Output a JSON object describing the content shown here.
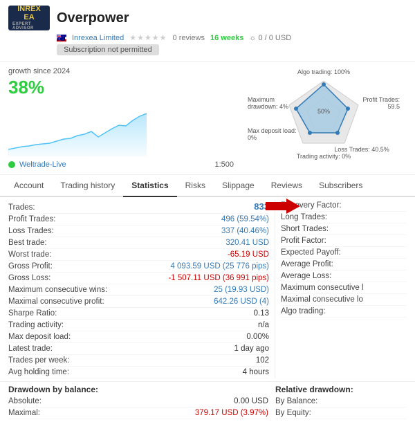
{
  "header": {
    "title": "Overpower",
    "logo_line1": "INREX EA",
    "logo_sub": "EXPERT ADVISOR",
    "provider": "Inrexea Limited",
    "stars": "★★★★★",
    "reviews_count": "0 reviews",
    "weeks": "16 weeks",
    "usd_info": "0 / 0 USD",
    "subscription_label": "Subscription not permitted"
  },
  "growth": {
    "since_label": "growth since 2024",
    "percent": "38%"
  },
  "server": {
    "name": "Weltrade-Live",
    "ratio": "1:500"
  },
  "radar": {
    "algo_label": "Algo trading: 100%",
    "profit_label": "Profit Trades:",
    "profit_value": "59.5",
    "loss_label": "Loss Trades: 40.5%",
    "max_drawdown_label": "Maximum drawdown: 4%",
    "max_deposit_label": "Max deposit load: 0%",
    "trading_activity_label": "Trading activity: 0%"
  },
  "tabs": [
    {
      "label": "Account",
      "active": false
    },
    {
      "label": "Trading history",
      "active": false
    },
    {
      "label": "Statistics",
      "active": true
    },
    {
      "label": "Risks",
      "active": false
    },
    {
      "label": "Slippage",
      "active": false
    },
    {
      "label": "Reviews",
      "active": false
    },
    {
      "label": "Subscribers",
      "active": false
    }
  ],
  "stats_left": [
    {
      "label": "Trades:",
      "value": "833",
      "color": "blue",
      "big": true
    },
    {
      "label": "Profit Trades:",
      "value": "496 (59.54%)",
      "color": "blue"
    },
    {
      "label": "Loss Trades:",
      "value": "337 (40.46%)",
      "color": "blue"
    },
    {
      "label": "Best trade:",
      "value": "320.41 USD",
      "color": "blue"
    },
    {
      "label": "Worst trade:",
      "value": "-65.19 USD",
      "color": "red"
    },
    {
      "label": "Gross Profit:",
      "value": "4 093.59 USD (25 776 pips)",
      "color": "blue"
    },
    {
      "label": "Gross Loss:",
      "value": "-1 507.11 USD (36 991 pips)",
      "color": "red"
    },
    {
      "label": "Maximum consecutive wins:",
      "value": "25 (19.93 USD)",
      "color": "blue"
    },
    {
      "label": "Maximal consecutive profit:",
      "value": "642.26 USD (4)",
      "color": "blue"
    },
    {
      "label": "Sharpe Ratio:",
      "value": "0.13",
      "color": "dark"
    },
    {
      "label": "Trading activity:",
      "value": "n/a",
      "color": "dark"
    },
    {
      "label": "Max deposit load:",
      "value": "0.00%",
      "color": "dark"
    },
    {
      "label": "Latest trade:",
      "value": "1 day ago",
      "color": "dark"
    },
    {
      "label": "Trades per week:",
      "value": "102",
      "color": "dark"
    },
    {
      "label": "Avg holding time:",
      "value": "4 hours",
      "color": "dark"
    }
  ],
  "stats_right": [
    {
      "label": "Recovery Factor:",
      "value": ""
    },
    {
      "label": "Long Trades:",
      "value": ""
    },
    {
      "label": "Short Trades:",
      "value": ""
    },
    {
      "label": "Profit Factor:",
      "value": ""
    },
    {
      "label": "Expected Payoff:",
      "value": ""
    },
    {
      "label": "Average Profit:",
      "value": ""
    },
    {
      "label": "Average Loss:",
      "value": ""
    },
    {
      "label": "Maximum consecutive l",
      "value": ""
    },
    {
      "label": "Maximal consecutive lo",
      "value": ""
    },
    {
      "label": "Algo trading:",
      "value": ""
    }
  ],
  "drawdown_left": {
    "title": "Drawdown by balance:",
    "rows": [
      {
        "label": "Absolute:",
        "value": "0.00 USD",
        "color": "dark"
      },
      {
        "label": "Maximal:",
        "value": "379.17 USD (3.97%)",
        "color": "red"
      }
    ]
  },
  "drawdown_right": {
    "title": "Relative drawdown:",
    "rows": [
      {
        "label": "By Balance:",
        "value": ""
      },
      {
        "label": "By Equity:",
        "value": ""
      }
    ]
  }
}
